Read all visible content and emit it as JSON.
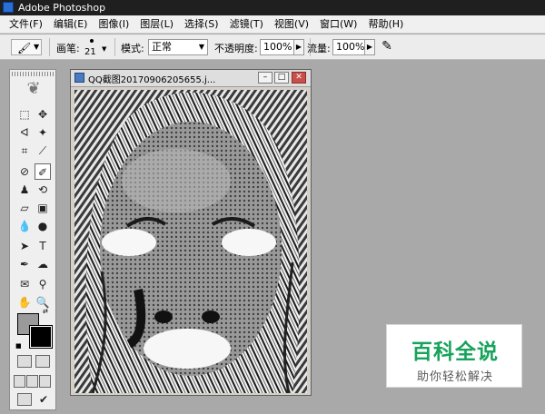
{
  "app": {
    "title": "Adobe Photoshop",
    "icon": "photoshop-app-icon"
  },
  "menu": [
    "文件(F)",
    "编辑(E)",
    "图像(I)",
    "图层(L)",
    "选择(S)",
    "滤镜(T)",
    "视图(V)",
    "窗口(W)",
    "帮助(H)"
  ],
  "options": {
    "brush_label": "画笔:",
    "brush_size": "21",
    "mode_label": "模式:",
    "mode_value": "正常",
    "opacity_label": "不透明度:",
    "opacity_value": "100%",
    "flow_label": "流量:",
    "flow_value": "100%"
  },
  "document": {
    "title": "QQ截图20170906205655.j..."
  },
  "colors": {
    "foreground": "#9a9a9a",
    "background": "#000000",
    "accent": "#17a35b"
  },
  "watermark": {
    "top": "百科全说",
    "bottom": "助你轻松解决"
  }
}
